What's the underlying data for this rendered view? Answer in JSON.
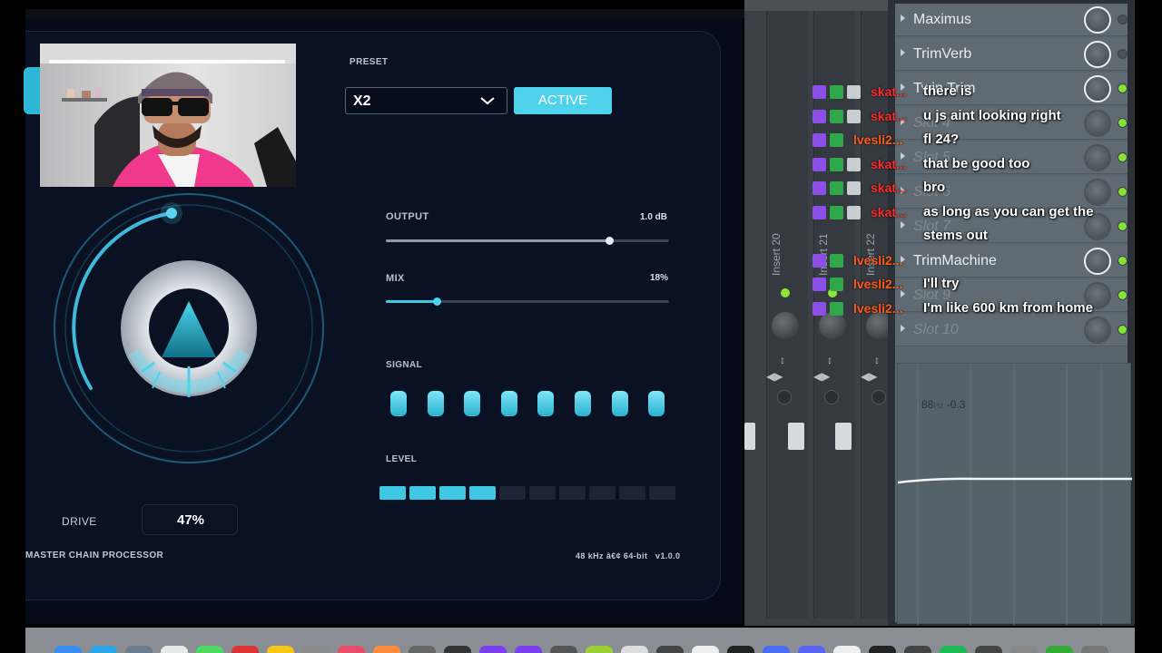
{
  "plugin": {
    "preset_label": "PRESET",
    "preset_value": "X2",
    "active_button": "ACTIVE",
    "output": {
      "label": "OUTPUT",
      "value": "1.0 dB",
      "fraction": 0.79
    },
    "mix": {
      "label": "MIX",
      "value": "18%",
      "fraction": 0.18
    },
    "signal_label": "SIGNAL",
    "signal_pill_count": 8,
    "level_label": "LEVEL",
    "level": {
      "segments": 10,
      "active": 4
    },
    "drive_label": "DRIVE",
    "drive_value": "47%",
    "footer_left": "MASTER CHAIN PROCESSOR",
    "footer_right": "48 kHz â€¢ 64-bit   v1.0.0",
    "accent_color": "#3fc8e4",
    "panel_color": "#0a1123"
  },
  "mixer": {
    "strips": [
      "Insert 20",
      "Insert 21",
      "Insert 22"
    ]
  },
  "rack": {
    "slots": [
      {
        "name": "Maximus",
        "active": true,
        "led": "off"
      },
      {
        "name": "TrimVerb",
        "active": true,
        "led": "off"
      },
      {
        "name": "Twin Trim",
        "active": true,
        "led": "on"
      },
      {
        "name": "Slot 4",
        "active": false,
        "led": "on"
      },
      {
        "name": "Slot 5",
        "active": false,
        "led": "on"
      },
      {
        "name": "Slot 6",
        "active": false,
        "led": "on"
      },
      {
        "name": "Slot 7",
        "active": false,
        "led": "on"
      },
      {
        "name": "TrimMachine",
        "active": true,
        "led": "on"
      },
      {
        "name": "Slot 9",
        "active": false,
        "led": "on"
      },
      {
        "name": "Slot 10",
        "active": false,
        "led": "on"
      }
    ],
    "graph_freq": "88",
    "graph_unit": "Hz",
    "graph_gain": "-0.3"
  },
  "chat": {
    "messages": [
      {
        "user": "skat...",
        "text": "there is",
        "color": "#ff2a2a",
        "badges": 3
      },
      {
        "user": "skat...",
        "text": "u js aint looking right",
        "color": "#ff2a2a",
        "badges": 3
      },
      {
        "user": "lvesli2...",
        "text": "fl 24?",
        "color": "#ff5a1a",
        "badges": 2
      },
      {
        "user": "skat...",
        "text": "that be good too",
        "color": "#ff2a2a",
        "badges": 3
      },
      {
        "user": "skat...",
        "text": "bro",
        "color": "#ff2a2a",
        "badges": 3
      },
      {
        "user": "skat...",
        "text": "as long as you can get the",
        "color": "#ff2a2a",
        "badges": 3
      },
      {
        "user": "",
        "text": "stems out",
        "color": "#ff2a2a",
        "badges": 0
      },
      {
        "user": "lvesli2...",
        "text": "",
        "color": "#ff5a1a",
        "badges": 2
      },
      {
        "user": "lvesli2...",
        "text": "I'll try",
        "color": "#ff5a1a",
        "badges": 2
      },
      {
        "user": "lvesli2...",
        "text": "I'm like 600 km from home",
        "color": "#ff5a1a",
        "badges": 2
      }
    ]
  },
  "dock": {
    "icons": [
      "finder-icon",
      "safari-icon",
      "mail-icon",
      "notes-icon",
      "messages-icon",
      "mixer-app-icon",
      "folder-icon",
      "photos-icon",
      "music-icon",
      "podcast-icon",
      "settings-icon",
      "terminal-icon",
      "chat-app-icon",
      "video-app-icon",
      "plugin-icon",
      "audio-app-icon",
      "store-icon",
      "window-icon",
      "app-icon",
      "app-icon-2",
      "code-icon",
      "discord-icon",
      "shield-icon",
      "recording-icon",
      "scissors-icon",
      "spotify-icon",
      "controller-icon",
      "calculator-icon",
      "maps-icon",
      "bin-icon"
    ]
  }
}
